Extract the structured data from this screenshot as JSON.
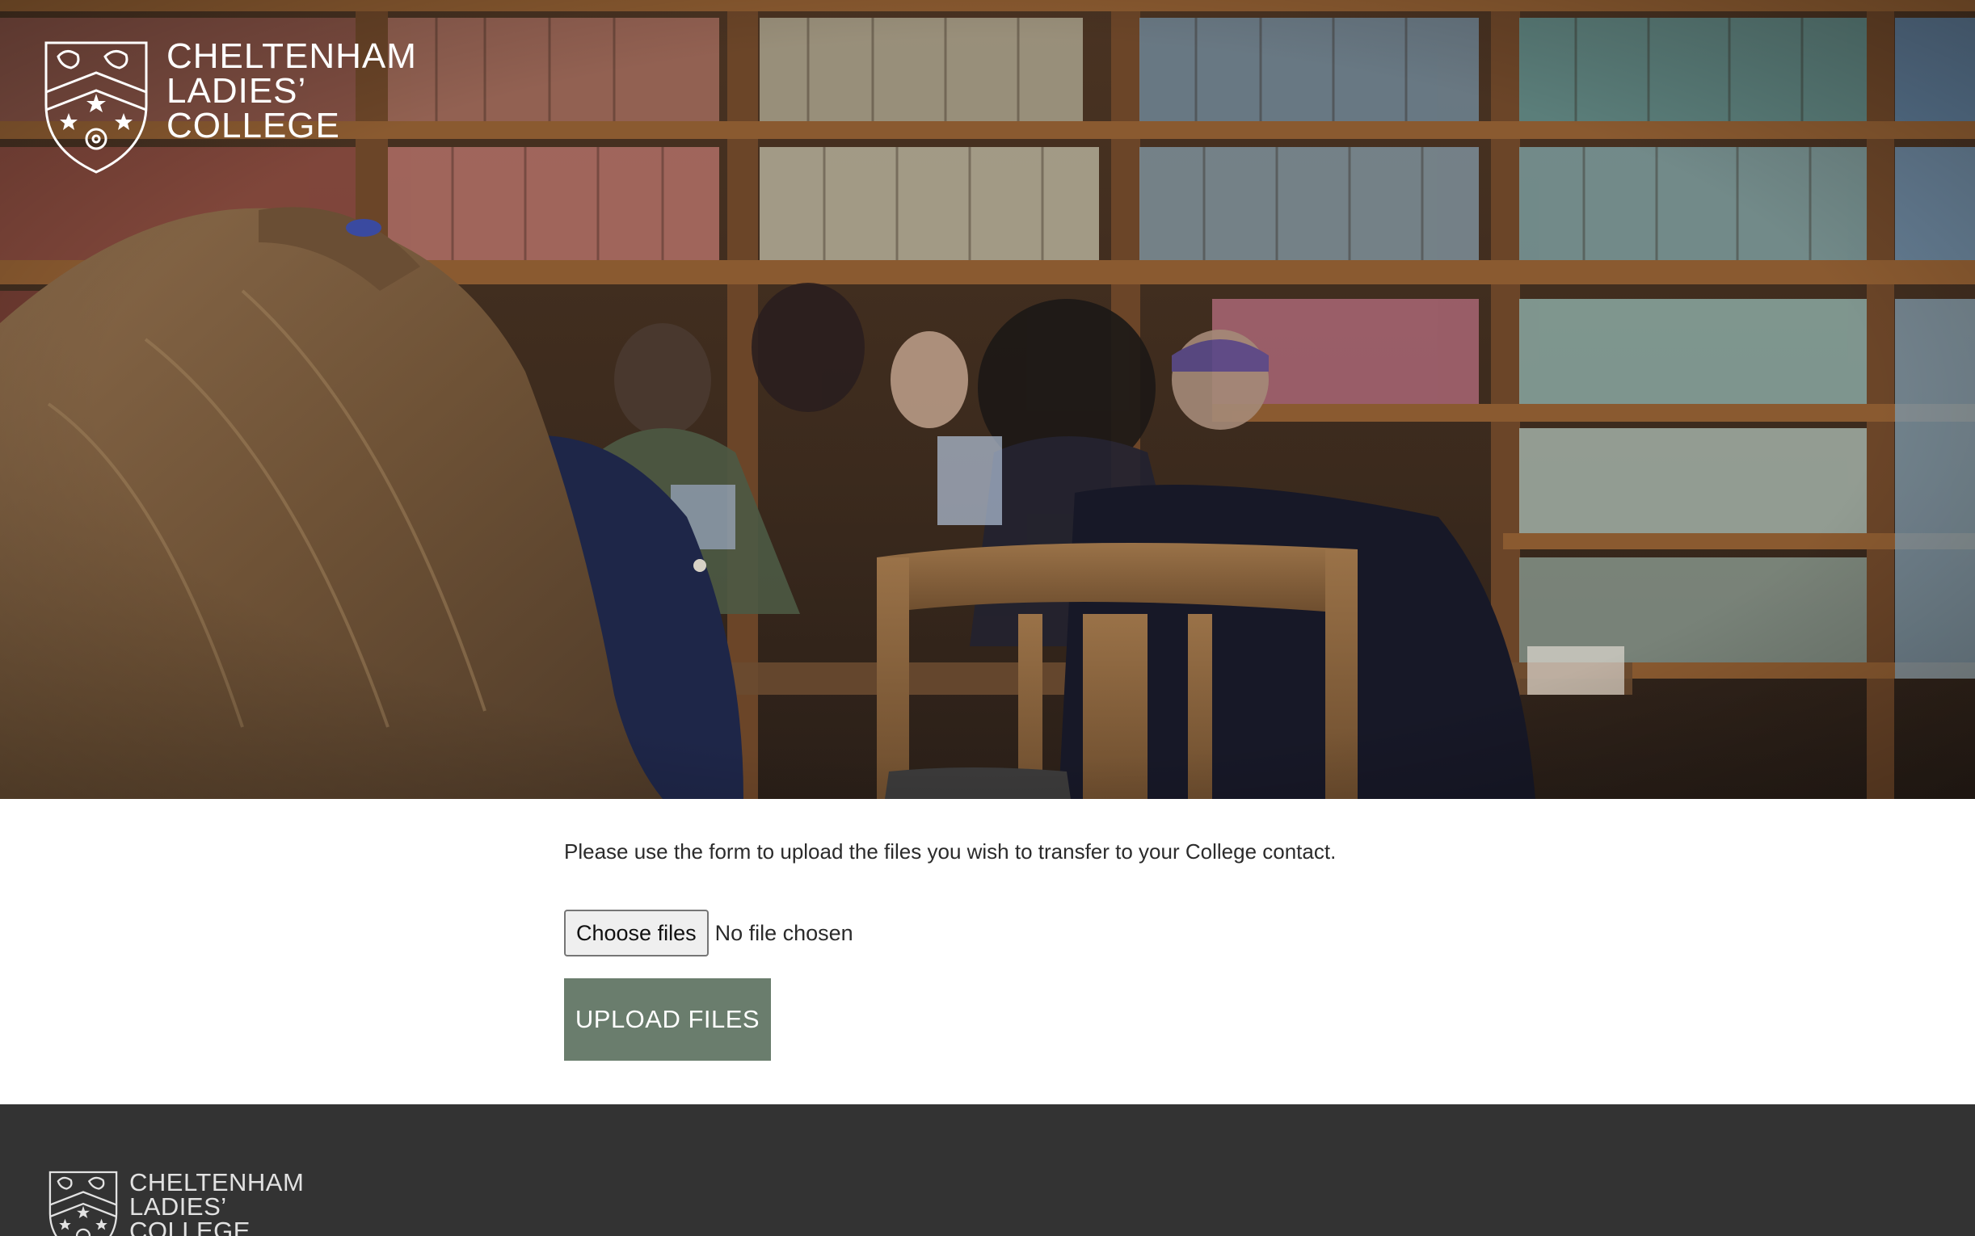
{
  "header": {
    "logo": {
      "icon": "college-crest-icon",
      "lines": [
        "CHELTENHAM",
        "LADIES’",
        "COLLEGE"
      ]
    },
    "hero_image": "library-students-photo"
  },
  "upload_form": {
    "instructions": "Please use the form to upload the files you wish to transfer to your College contact.",
    "choose_files_label": "Choose files",
    "file_status": "No file chosen",
    "submit_label": "UPLOAD FILES"
  },
  "footer": {
    "logo": {
      "icon": "college-crest-icon",
      "lines": [
        "CHELTENHAM",
        "LADIES’",
        "COLLEGE"
      ]
    }
  },
  "colors": {
    "upload_button": "#6a7d6d",
    "footer_background": "#333333",
    "text": "#2b2b2b"
  }
}
